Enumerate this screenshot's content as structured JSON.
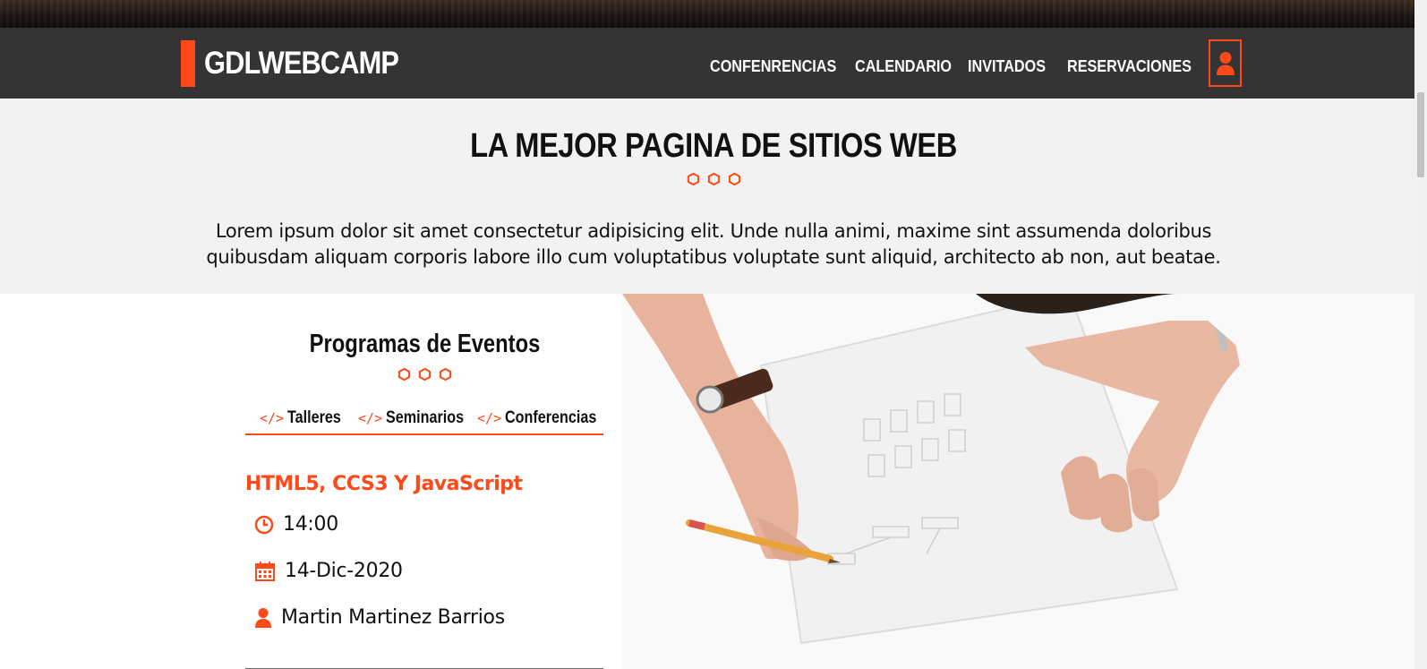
{
  "header": {
    "brand": "GDLWEBCAMP",
    "nav": [
      {
        "label": "CONFENRENCIAS"
      },
      {
        "label": "CALENDARIO"
      },
      {
        "label": "INVITADOS"
      },
      {
        "label": "RESERVACIONES"
      }
    ],
    "user_icon": "user-icon"
  },
  "intro": {
    "title": "LA MEJOR PAGINA DE SITIOS WEB",
    "text": "Lorem ipsum dolor sit amet consectetur adipisicing elit. Unde nulla animi, maxime sint assumenda doloribus quibusdam aliquam corporis labore illo cum voluptatibus voluptate sunt aliquid, architecto ab non, aut beatae."
  },
  "program": {
    "title": "Programas de Eventos",
    "tabs": [
      {
        "label": "Talleres",
        "icon": "code-icon"
      },
      {
        "label": "Seminarios",
        "icon": "code-icon"
      },
      {
        "label": "Conferencias",
        "icon": "code-icon"
      }
    ],
    "event": {
      "title": "HTML5, CCS3 Y JavaScript",
      "time": "14:00",
      "date": "14-Dic-2020",
      "speaker": "Martin Martinez Barrios"
    }
  },
  "colors": {
    "accent": "#fe4918",
    "navbar": "#343434",
    "intro_bg": "#f2f2f2"
  },
  "icons": [
    "hexagon-icon",
    "clock-icon",
    "calendar-icon",
    "user-icon",
    "code-icon"
  ]
}
